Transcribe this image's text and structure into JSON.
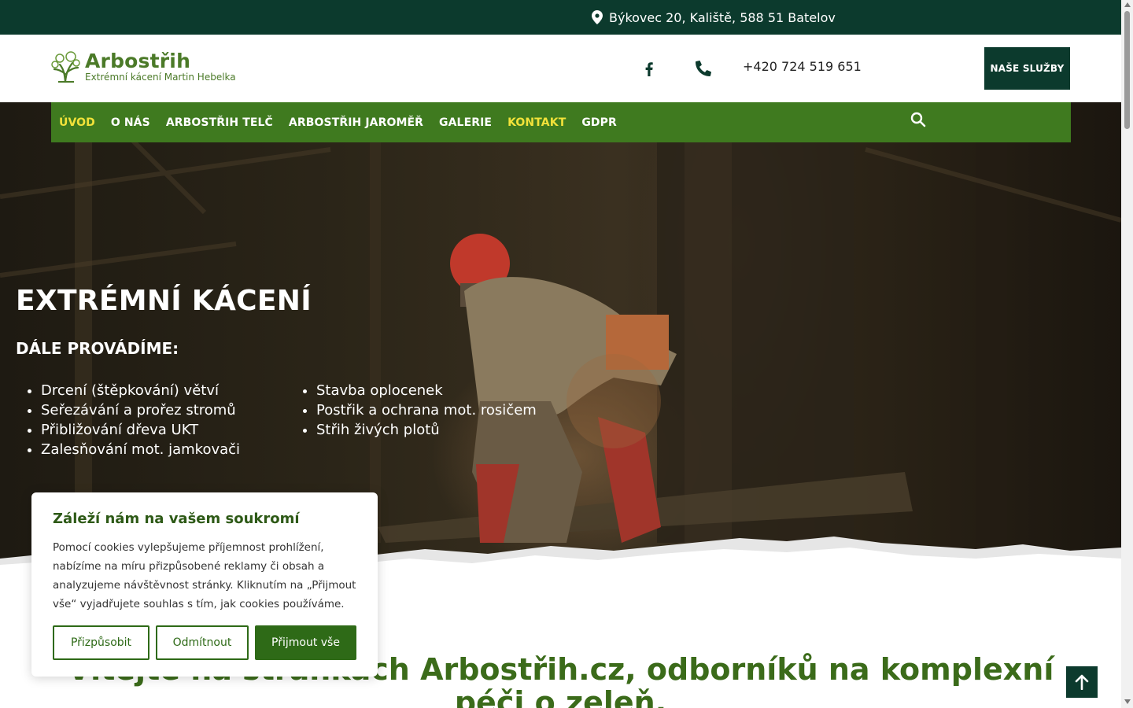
{
  "topbar": {
    "address": "Býkovec 20, Kaliště, 588 51 Batelov",
    "icon": "map-pin-icon"
  },
  "header": {
    "logo_name": "Arbostřih",
    "logo_tagline": "Extrémní kácení Martin Hebelka",
    "phone": "+420 724 519 651",
    "services_button": "NAŠE SLUŽBY",
    "icons": [
      "facebook-icon",
      "phone-icon"
    ]
  },
  "nav": {
    "items": [
      {
        "label": "ÚVOD",
        "active": true
      },
      {
        "label": "O NÁS",
        "active": false
      },
      {
        "label": "ARBOSTŘIH TELČ",
        "active": false
      },
      {
        "label": "ARBOSTŘIH JAROMĚŘ",
        "active": false
      },
      {
        "label": "GALERIE",
        "active": false
      },
      {
        "label": "KONTAKT",
        "active": true
      },
      {
        "label": "GDPR",
        "active": false
      }
    ],
    "search_icon": "search-icon"
  },
  "hero": {
    "title": "EXTRÉMNÍ KÁCENÍ",
    "subtitle": "DÁLE PROVÁDÍME:",
    "services_left": [
      "Drcení (štěpkování) větví",
      "Seřezávání a prořez stromů",
      "Přibližování dřeva UKT",
      "Zalesňování mot. jamkovači"
    ],
    "services_right": [
      "Stavba oplocenek",
      "Postřik a ochrana mot. rosičem",
      "Střih živých plotů"
    ]
  },
  "welcome": {
    "heading": "Vítejte na stránkách Arbostřih.cz, odborníků na komplexní péči o zeleň."
  },
  "cookie": {
    "title": "Záleží nám na vašem soukromí",
    "text": "Pomocí cookies vylepšujeme příjemnost prohlížení, nabízíme na míru přizpůsobené reklamy či obsah a analyzujeme návštěvnost stránky. Kliknutím na „Přijmout vše“ vyjadřujete souhlas s tím, jak cookies používáme.",
    "customize": "Přizpůsobit",
    "reject": "Odmítnout",
    "accept": "Přijmout vše"
  },
  "colors": {
    "dark_green": "#0c3a2d",
    "nav_green": "#3f7a1f",
    "active_yellow": "#f2e23a",
    "brand_green": "#4b7a28"
  }
}
